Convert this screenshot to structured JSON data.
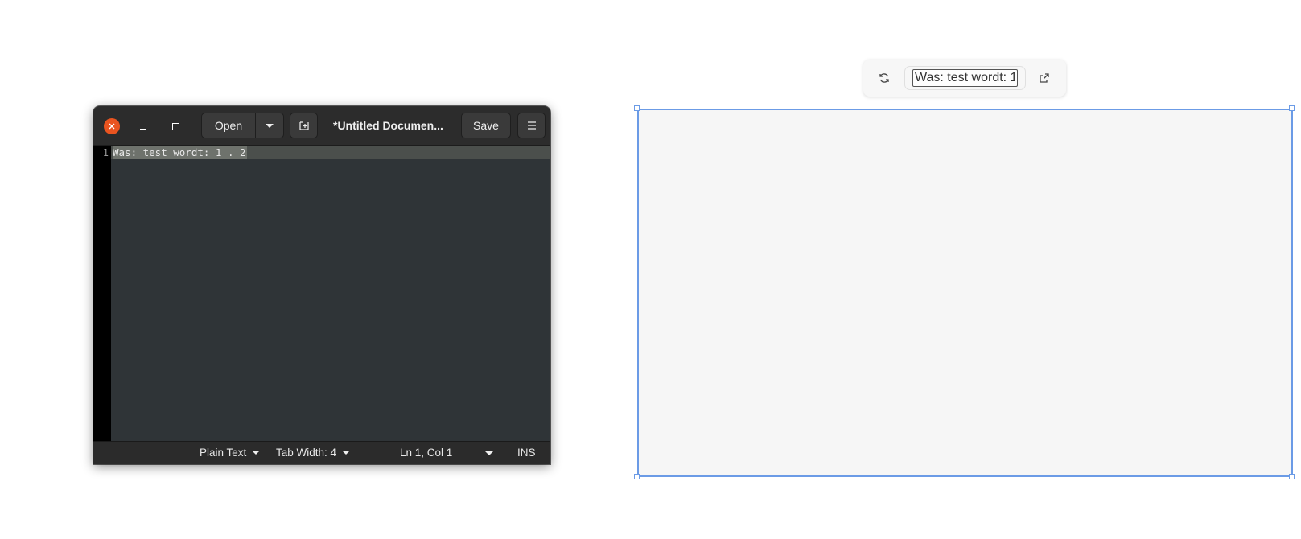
{
  "editor_window": {
    "toolbar": {
      "open_label": "Open",
      "save_label": "Save",
      "document_title": "*Untitled Documen..."
    },
    "line_numbers": [
      "1"
    ],
    "content_line": "Was: test wordt: 1 . 2",
    "statusbar": {
      "language": "Plain Text",
      "tab_width": "Tab Width: 4",
      "position": "Ln 1, Col 1",
      "mode": "INS"
    },
    "colors": {
      "close_button": "#e95420",
      "background": "#2f3437"
    }
  },
  "widget": {
    "title_input_value": "Was: test wordt: 1",
    "icons": [
      "refresh-icon",
      "external-link-icon"
    ],
    "colors": {
      "selection_border": "#6b9be6",
      "canvas": "#f6f6f6"
    }
  }
}
